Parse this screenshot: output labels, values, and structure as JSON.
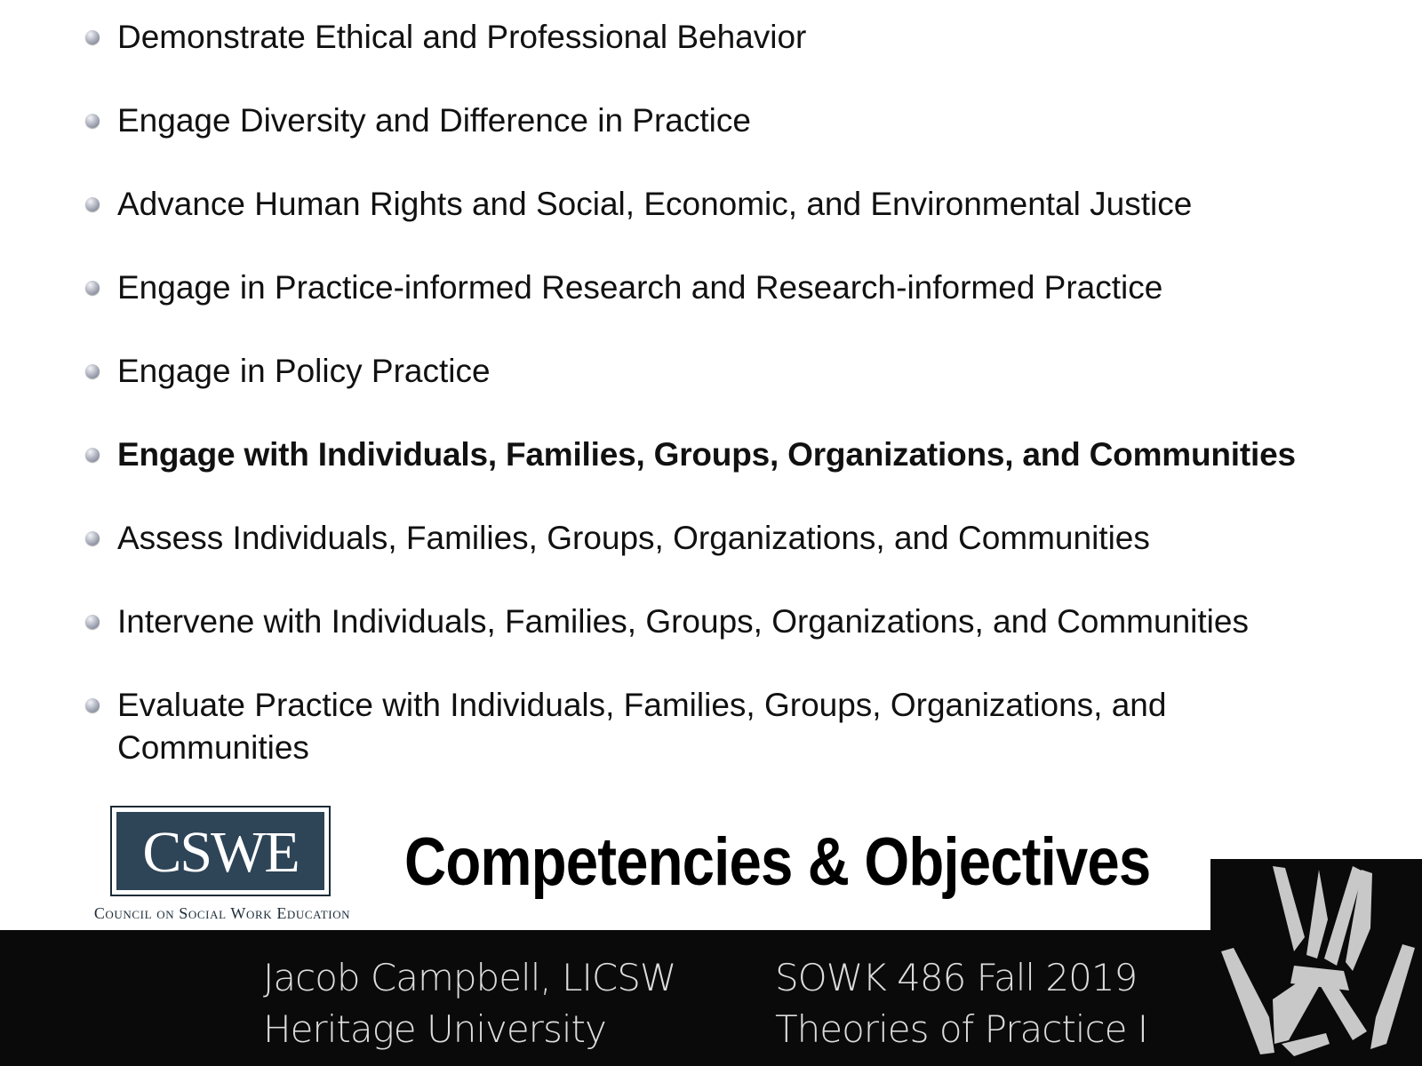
{
  "bullets": [
    {
      "text": "Demonstrate Ethical and Professional Behavior",
      "bold": false
    },
    {
      "text": "Engage Diversity and Difference in Practice",
      "bold": false
    },
    {
      "text": "Advance Human Rights and Social, Economic, and Environmental Justice",
      "bold": false
    },
    {
      "text": "Engage in Practice-informed Research and Research-informed Practice",
      "bold": false
    },
    {
      "text": "Engage in Policy Practice",
      "bold": false
    },
    {
      "text": "Engage with Individuals, Families, Groups, Organizations, and Communities",
      "bold": true
    },
    {
      "text": "Assess Individuals, Families, Groups, Organizations, and Communities",
      "bold": false
    },
    {
      "text": "Intervene with Individuals, Families, Groups, Organizations, and Communities",
      "bold": false
    },
    {
      "text": "Evaluate Practice with Individuals, Families, Groups, Organizations, and Communities",
      "bold": false
    }
  ],
  "logo": {
    "letters": "CSWE",
    "caption": "Council on Social Work Education",
    "bg_color": "#2e4457"
  },
  "title": "Competencies & Objectives",
  "footer": {
    "author": "Jacob Campbell, LICSW",
    "institution": "Heritage University",
    "course": "SOWK 486 Fall 2019",
    "course_title": "Theories of Practice I"
  },
  "corner_icon": "multitool-logo-icon"
}
